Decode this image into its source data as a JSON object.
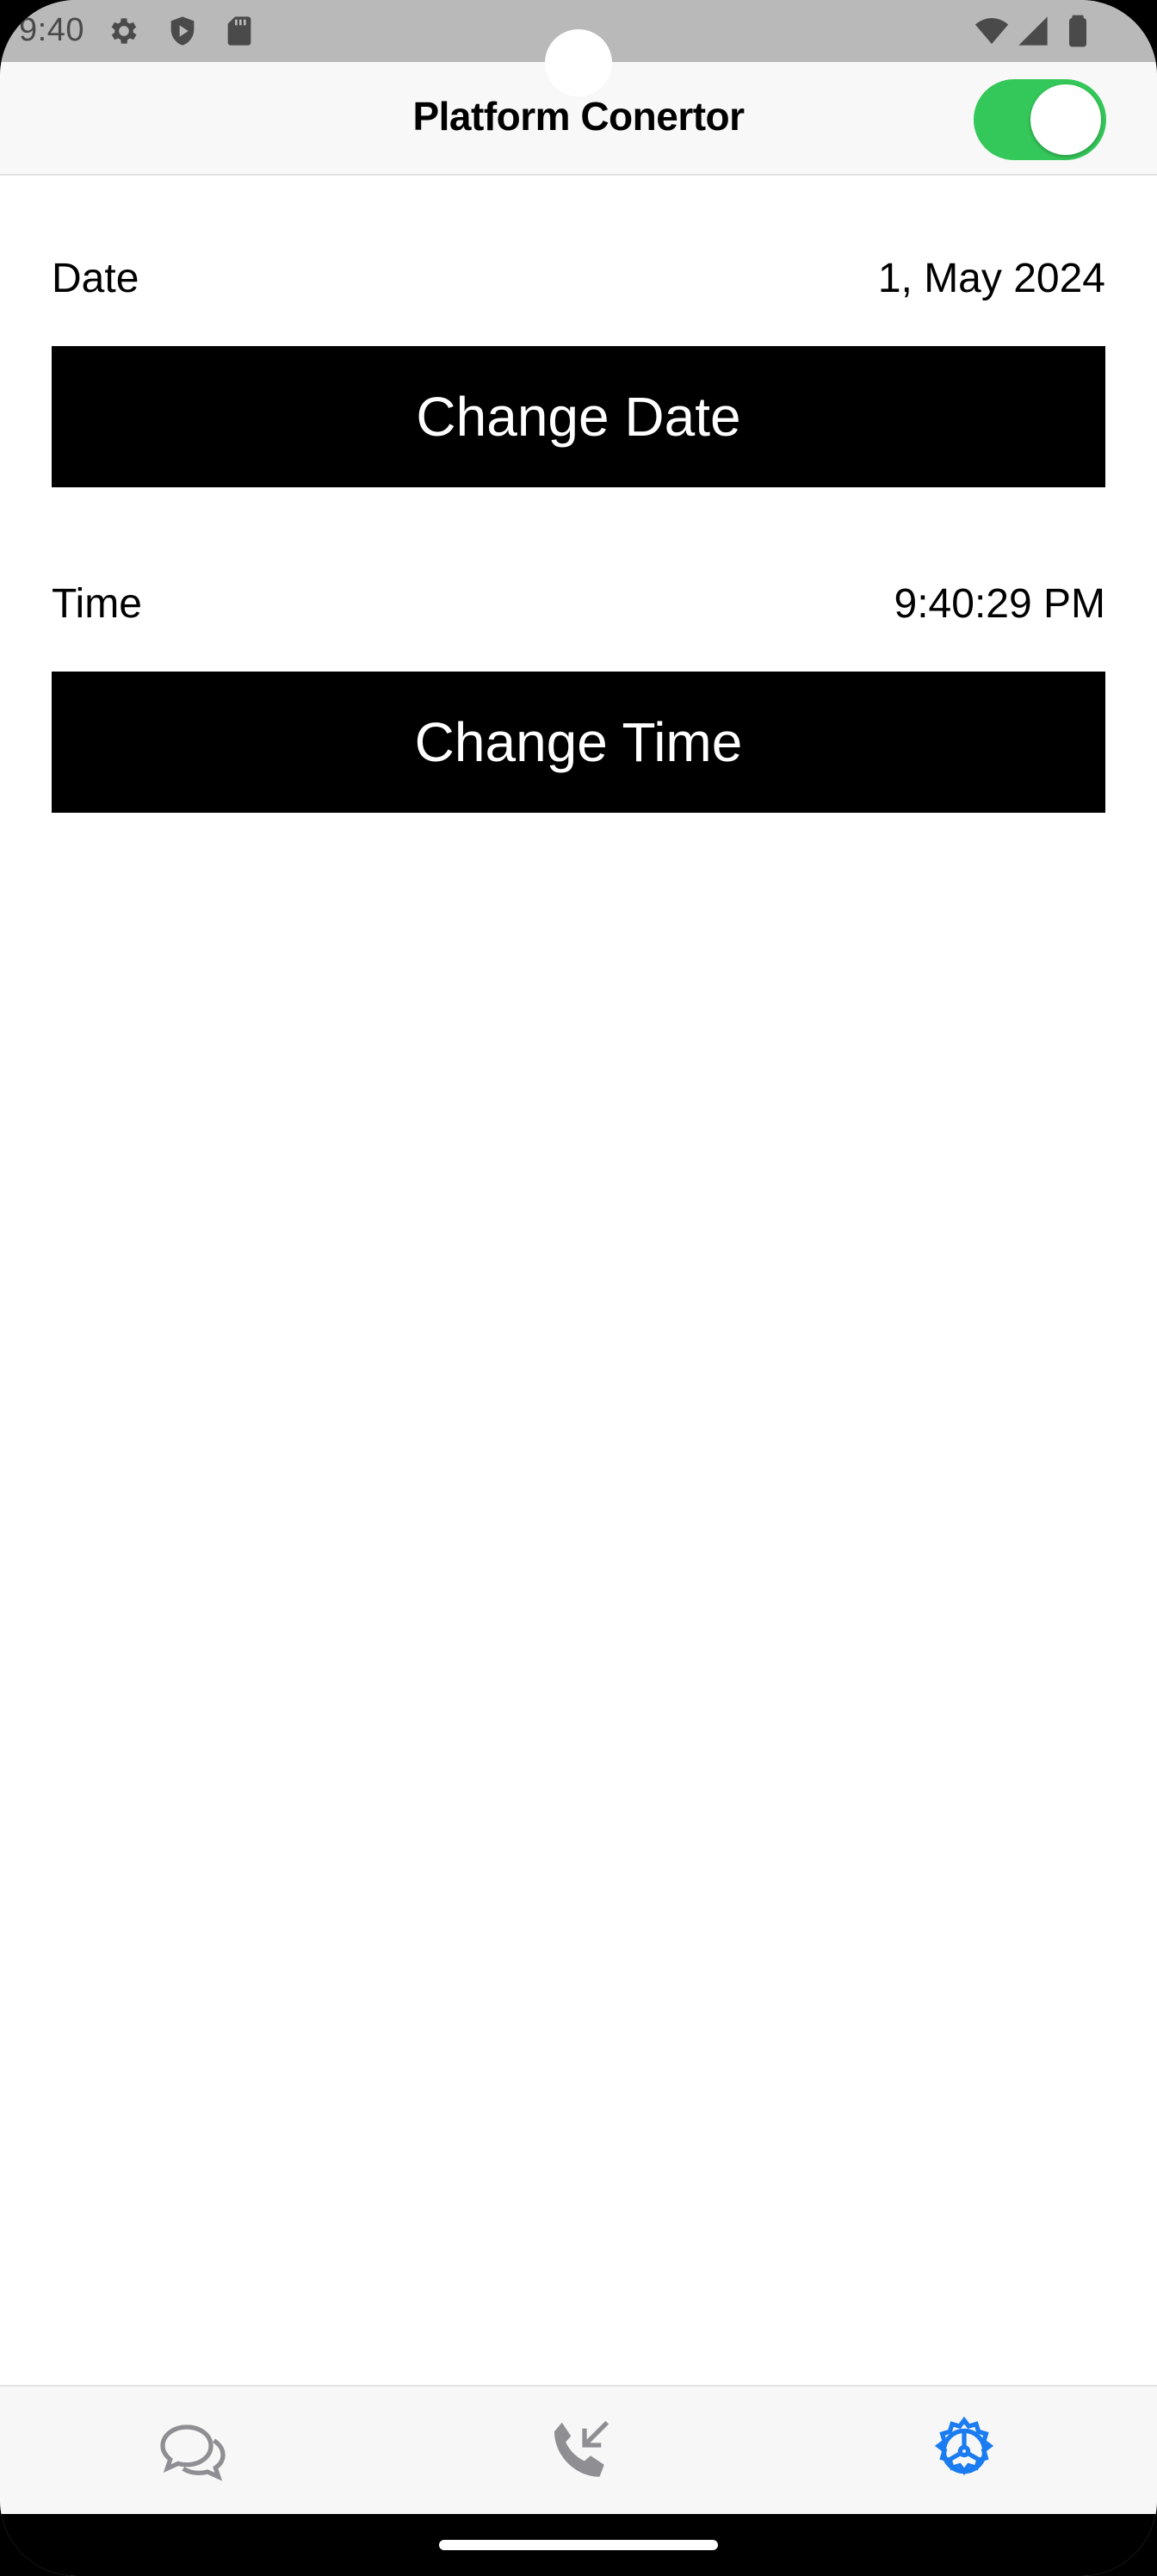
{
  "status_bar": {
    "time": "9:40",
    "left_icons": [
      "gear-icon",
      "shield-play-icon",
      "sd-card-icon"
    ],
    "right_icons": [
      "wifi-icon",
      "cell-signal-icon",
      "battery-icon"
    ]
  },
  "header": {
    "title": "Platform Conertor",
    "toggle_on": true,
    "toggle_color": "#34c759"
  },
  "date_section": {
    "label": "Date",
    "value": "1, May 2024",
    "button_label": "Change Date"
  },
  "time_section": {
    "label": "Time",
    "value": "9:40:29 PM",
    "button_label": "Change Time"
  },
  "tab_bar": {
    "tabs": [
      {
        "icon": "chat-bubbles-icon",
        "active": false
      },
      {
        "icon": "phone-incoming-icon",
        "active": false
      },
      {
        "icon": "settings-wheel-icon",
        "active": true
      }
    ],
    "active_color": "#1a7cf0",
    "inactive_color": "#8e8e93"
  }
}
